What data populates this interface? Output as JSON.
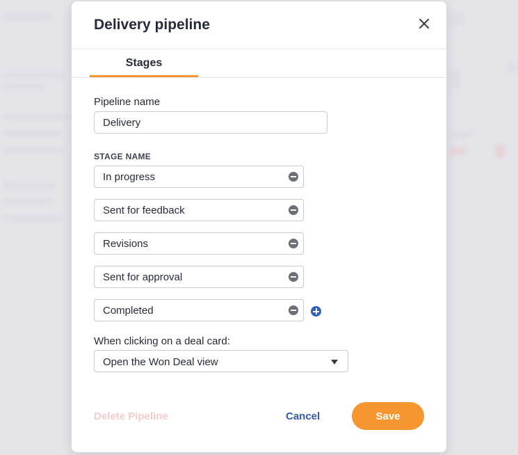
{
  "modal": {
    "title": "Delivery pipeline",
    "tabs": [
      {
        "label": "Stages",
        "active": true
      }
    ],
    "pipeline_name_label": "Pipeline name",
    "pipeline_name_value": "Delivery",
    "stage_name_label": "STAGE NAME",
    "stages": [
      {
        "value": "In progress"
      },
      {
        "value": "Sent for feedback"
      },
      {
        "value": "Revisions"
      },
      {
        "value": "Sent for approval"
      },
      {
        "value": "Completed"
      }
    ],
    "deal_card_label": "When clicking on a deal card:",
    "deal_card_selected": "Open the Won Deal view",
    "delete_label": "Delete Pipeline",
    "cancel_label": "Cancel",
    "save_label": "Save"
  },
  "colors": {
    "accent": "#f7962e",
    "link": "#2f5ba8",
    "delete_disabled": "#f6cccc",
    "add_icon": "#2f62b3"
  }
}
